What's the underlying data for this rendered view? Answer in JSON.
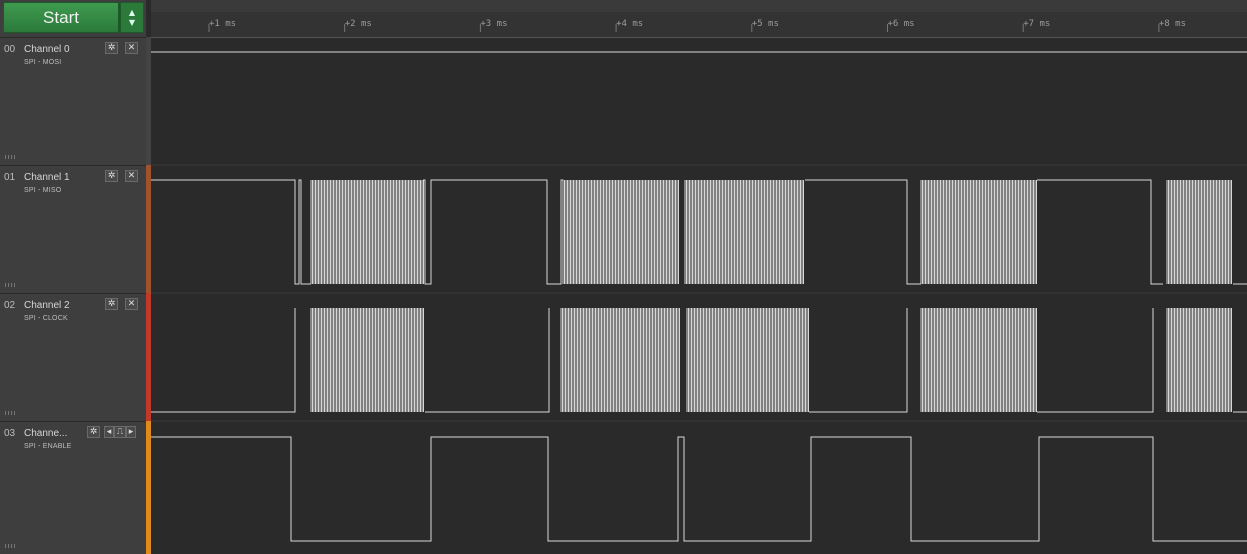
{
  "start": {
    "label": "Start"
  },
  "timeline": {
    "ticks": [
      "+1 ms",
      "+2 ms",
      "+3 ms",
      "+4 ms",
      "+5 ms",
      "+6 ms",
      "+7 ms",
      "+8 ms"
    ]
  },
  "channels": [
    {
      "number": "00",
      "name": "Channel 0",
      "subtitle": "SPI - MOSI",
      "color": "#4a4a4a"
    },
    {
      "number": "01",
      "name": "Channel 1",
      "subtitle": "SPI - MISO",
      "color": "#a0522d"
    },
    {
      "number": "02",
      "name": "Channel 2",
      "subtitle": "SPI - CLOCK",
      "color": "#c0392b"
    },
    {
      "number": "03",
      "name": "Channe...",
      "subtitle": "SPI - ENABLE",
      "color": "#e08a1a"
    }
  ],
  "icons": {
    "gear": "gear-icon",
    "close": "close-icon",
    "prev": "prev-edge-icon",
    "trigger": "trigger-icon",
    "next": "next-edge-icon"
  }
}
